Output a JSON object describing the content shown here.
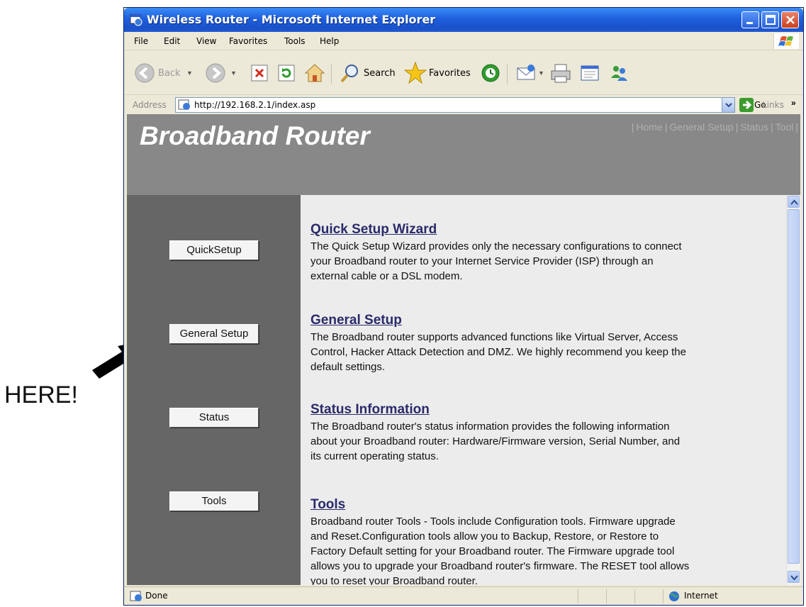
{
  "annotation": {
    "text": "HERE!"
  },
  "window": {
    "title": "Wireless Router - Microsoft Internet Explorer",
    "menu": [
      "File",
      "Edit",
      "View",
      "Favorites",
      "Tools",
      "Help"
    ],
    "toolbar": {
      "back_label": "Back",
      "search_label": "Search",
      "favorites_label": "Favorites"
    },
    "address": {
      "label": "Address",
      "url": "http://192.168.2.1/index.asp",
      "go_label": "Go",
      "links_label": "Links"
    },
    "status": {
      "text": "Done",
      "zone": "Internet"
    }
  },
  "page": {
    "brand": "Broadband Router",
    "topnav": [
      "Home",
      "General Setup",
      "Status",
      "Tool"
    ],
    "sidebar": [
      "QuickSetup",
      "General Setup",
      "Status",
      "Tools"
    ],
    "sections": [
      {
        "title": "Quick Setup Wizard",
        "body": "The Quick Setup Wizard provides only the necessary configurations to connect your Broadband router to your Internet Service Provider (ISP) through an external cable or a DSL modem."
      },
      {
        "title": "General Setup",
        "body": "The Broadband router supports advanced functions like Virtual Server, Access Control, Hacker Attack Detection and DMZ. We highly recommend you keep the default settings."
      },
      {
        "title": "Status Information",
        "body": "The Broadband router's status information provides the following information about your Broadband router: Hardware/Firmware version, Serial Number, and its current operating status."
      },
      {
        "title": "Tools",
        "body": "Broadband router Tools - Tools include Configuration tools. Firmware upgrade and Reset.Configuration tools allow you to Backup, Restore, or Restore to Factory Default setting for your Broadband router. The Firmware upgrade tool allows you to upgrade your Broadband router's firmware. The RESET tool allows you to reset your Broadband router."
      }
    ]
  }
}
